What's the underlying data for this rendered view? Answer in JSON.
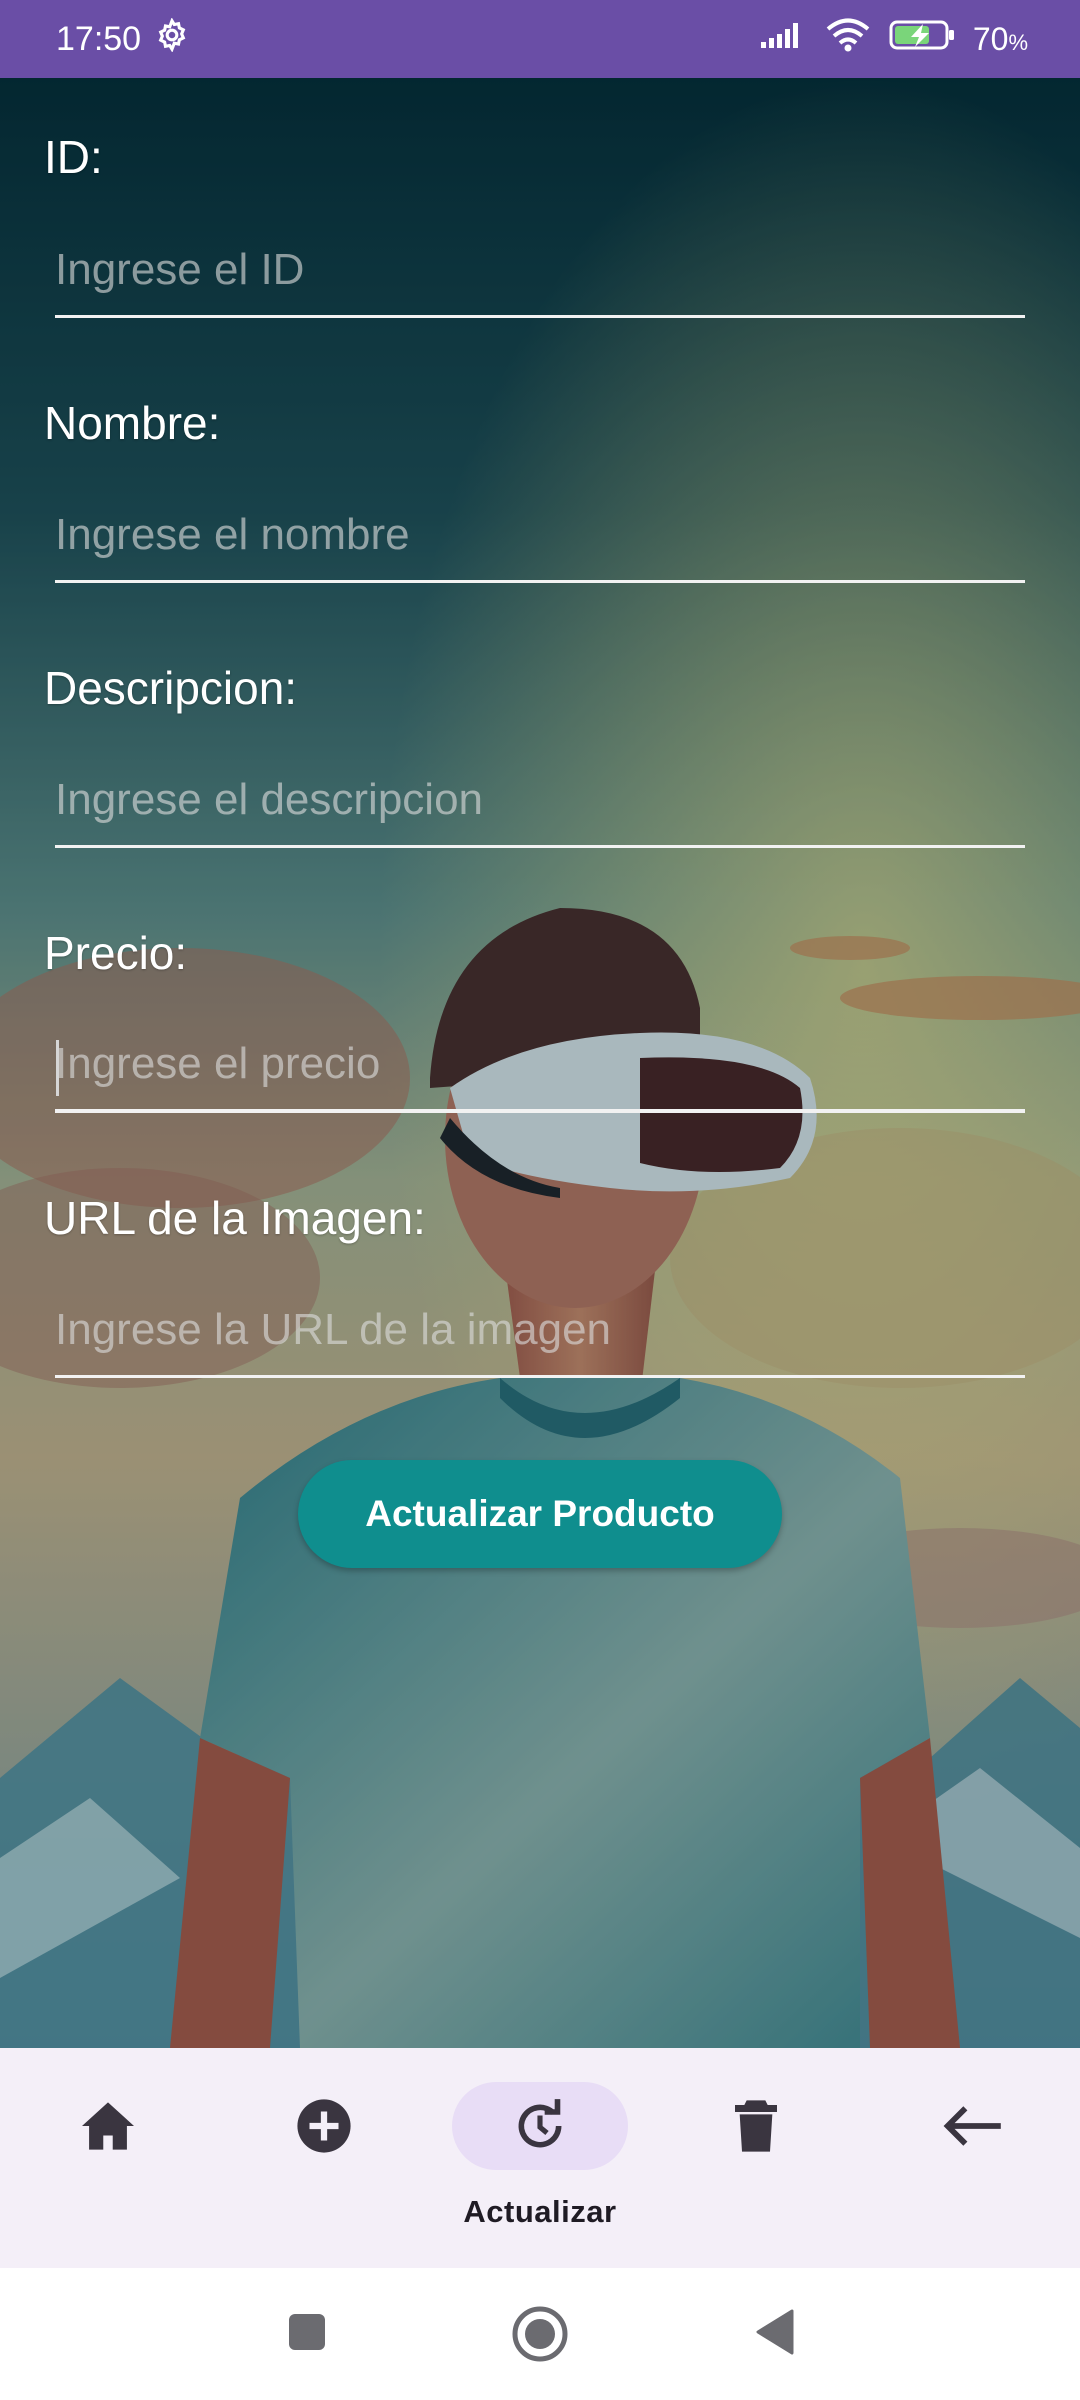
{
  "status_bar": {
    "time": "17:50",
    "battery": "70",
    "battery_unit": "%",
    "icons": [
      "gear-icon",
      "signal-icon",
      "wifi-icon",
      "battery-charging-icon"
    ]
  },
  "form": {
    "fields": [
      {
        "label": "ID:",
        "placeholder": "Ingrese el ID",
        "value": ""
      },
      {
        "label": "Nombre:",
        "placeholder": "Ingrese el nombre",
        "value": ""
      },
      {
        "label": "Descripcion:",
        "placeholder": "Ingrese el descripcion",
        "value": ""
      },
      {
        "label": "Precio:",
        "placeholder": "Ingrese el precio",
        "value": ""
      },
      {
        "label": "URL de la Imagen:",
        "placeholder": "Ingrese la URL de la imagen",
        "value": ""
      }
    ],
    "submit_label": "Actualizar Producto"
  },
  "bottom_nav": {
    "items": [
      {
        "icon": "home-icon"
      },
      {
        "icon": "add-circle-icon"
      },
      {
        "icon": "update-icon",
        "label": "Actualizar",
        "selected": true
      },
      {
        "icon": "delete-icon"
      },
      {
        "icon": "arrow-back-icon"
      }
    ]
  },
  "system_nav": {
    "icons": [
      "recents-icon",
      "home-circle-icon",
      "back-triangle-icon"
    ]
  },
  "colors": {
    "status_bar": "#6a4ea6",
    "button": "#0f8e8e",
    "nav_background": "#f4eff8",
    "nav_pill": "#e8ddf6"
  }
}
